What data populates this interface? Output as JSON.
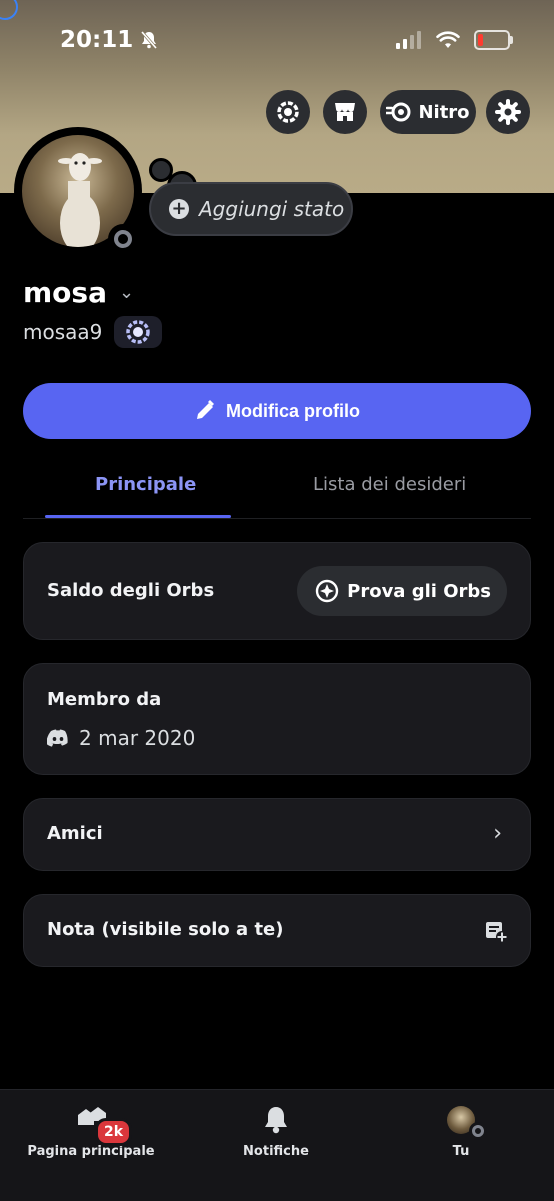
{
  "status_bar": {
    "time": "20:11"
  },
  "header": {
    "nitro_label": "Nitro"
  },
  "profile": {
    "status_placeholder": "Aggiungi stato",
    "display_name": "mosa",
    "username": "mosaa9",
    "edit_button_label": "Modifica profilo"
  },
  "tabs": [
    {
      "label": "Principale",
      "active": true
    },
    {
      "label": "Lista dei desideri",
      "active": false
    }
  ],
  "cards": {
    "orbs": {
      "title": "Saldo degli Orbs",
      "button_label": "Prova gli Orbs"
    },
    "member": {
      "title": "Membro da",
      "date": "2 mar 2020"
    },
    "friends": {
      "title": "Amici"
    },
    "note": {
      "title": "Nota (visibile solo a te)"
    }
  },
  "bottom_nav": {
    "home_label": "Pagina principale",
    "home_badge": "2k",
    "notifications_label": "Notifiche",
    "you_label": "Tu"
  },
  "colors": {
    "accent": "#5865f2",
    "badge_red": "#da373c",
    "card_bg": "#1a1a1e"
  }
}
